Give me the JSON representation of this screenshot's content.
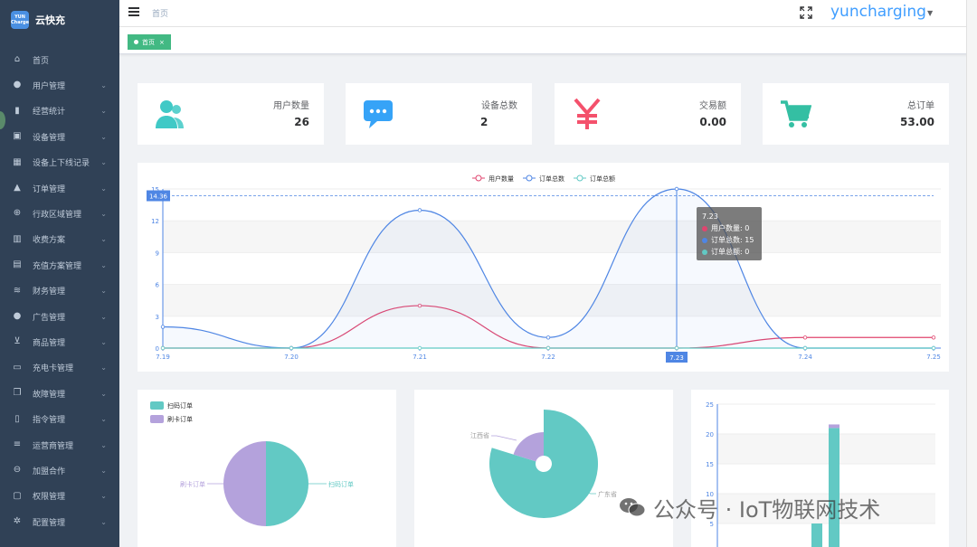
{
  "brand": {
    "logo_text": "YUN Charge",
    "name": "云快充"
  },
  "sidebar": {
    "items": [
      {
        "label": "首页",
        "icon": "home-icon",
        "has_children": false
      },
      {
        "label": "用户管理",
        "icon": "user-icon",
        "has_children": true
      },
      {
        "label": "经营统计",
        "icon": "bar-chart-icon",
        "has_children": true
      },
      {
        "label": "设备管理",
        "icon": "device-icon",
        "has_children": true
      },
      {
        "label": "设备上下线记录",
        "icon": "calendar-icon",
        "has_children": true
      },
      {
        "label": "订单管理",
        "icon": "bag-icon",
        "has_children": true
      },
      {
        "label": "行政区域管理",
        "icon": "plus-circle-icon",
        "has_children": true
      },
      {
        "label": "收费方案",
        "icon": "book-icon",
        "has_children": true
      },
      {
        "label": "充值方案管理",
        "icon": "recharge-icon",
        "has_children": true
      },
      {
        "label": "财务管理",
        "icon": "database-icon",
        "has_children": true
      },
      {
        "label": "广告管理",
        "icon": "pin-icon",
        "has_children": true
      },
      {
        "label": "商品管理",
        "icon": "cart-icon",
        "has_children": true
      },
      {
        "label": "充电卡管理",
        "icon": "folder-icon",
        "has_children": true
      },
      {
        "label": "故障管理",
        "icon": "copy-icon",
        "has_children": true
      },
      {
        "label": "指令管理",
        "icon": "doc-icon",
        "has_children": true
      },
      {
        "label": "运营商管理",
        "icon": "list-icon",
        "has_children": true
      },
      {
        "label": "加盟合作",
        "icon": "link-icon",
        "has_children": true
      },
      {
        "label": "权限管理",
        "icon": "lock-icon",
        "has_children": true
      },
      {
        "label": "配置管理",
        "icon": "settings-icon",
        "has_children": true
      }
    ]
  },
  "header": {
    "breadcrumb": "首页",
    "user": "yuncharging"
  },
  "tags": {
    "active": "首页"
  },
  "stats": [
    {
      "label": "用户数量",
      "value": "26",
      "icon": "users-icon",
      "color": "#40c9c6"
    },
    {
      "label": "设备总数",
      "value": "2",
      "icon": "message-icon",
      "color": "#36a3f7"
    },
    {
      "label": "交易额",
      "value": "0.00",
      "icon": "yen-icon",
      "color": "#f4516c"
    },
    {
      "label": "总订单",
      "value": "53.00",
      "icon": "cart-icon",
      "color": "#34bfa3"
    }
  ],
  "colors": {
    "users": "#e0456f",
    "orders_count": "#4f86e4",
    "orders_amount": "#62c9c4"
  },
  "chart_data": [
    {
      "type": "line",
      "legend": [
        "用户数量",
        "订单总数",
        "订单总额"
      ],
      "x": [
        "7.19",
        "7.20",
        "7.21",
        "7.22",
        "7.23",
        "7.24",
        "7.25"
      ],
      "series": [
        {
          "name": "用户数量",
          "values": [
            0,
            0,
            4,
            0,
            0,
            1,
            1
          ]
        },
        {
          "name": "订单总数",
          "values": [
            2,
            0,
            13,
            1,
            15,
            0,
            0
          ]
        },
        {
          "name": "订单总额",
          "values": [
            0,
            0,
            0,
            0,
            0,
            0,
            0
          ]
        }
      ],
      "yticks": [
        0,
        3,
        6,
        9,
        12,
        15
      ],
      "ylim": [
        0,
        15
      ],
      "markline_value": "14.36",
      "axis_pointer_label": "7.23",
      "tooltip": {
        "title": "7.23",
        "rows": [
          "用户数量: 0",
          "订单总数: 15",
          "订单总额: 0"
        ]
      }
    },
    {
      "type": "pie",
      "legend": [
        "扫码订单",
        "刷卡订单"
      ],
      "slices": [
        {
          "name": "扫码订单",
          "value": 50,
          "color": "#62c9c4"
        },
        {
          "name": "刷卡订单",
          "value": 50,
          "color": "#b4a2dc"
        }
      ]
    },
    {
      "type": "pie",
      "slices": [
        {
          "name": "广东省",
          "value": 75,
          "color": "#62c9c4"
        },
        {
          "name": "江西省",
          "value": 25,
          "color": "#b4a2dc"
        }
      ]
    },
    {
      "type": "bar",
      "yticks": [
        5,
        10,
        15,
        20,
        25
      ],
      "ylim": [
        0,
        25
      ],
      "bars": [
        {
          "segments": [
            5
          ]
        },
        {
          "segments": [
            21,
            0.6
          ]
        }
      ]
    }
  ],
  "watermark": "公众号 · IoT物联网技术"
}
